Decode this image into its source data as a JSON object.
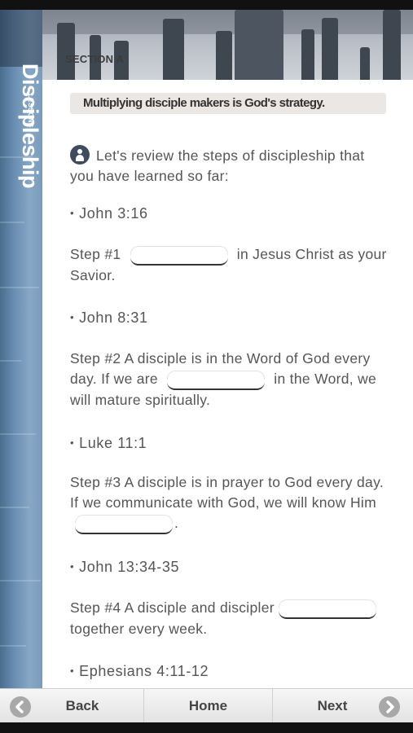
{
  "header": {
    "section_label": "SECTION A",
    "subtitle": "Multiplying disciple makers is God's strategy."
  },
  "sidebar": {
    "title": "Discipleship",
    "subtitle": "LESSONS"
  },
  "content": {
    "intro_icon": "info-person-icon",
    "intro": "Let's review the steps of discipleship that you have learned so far:",
    "blocks": [
      {
        "verse": "John 3:16",
        "step_before": "Step #1",
        "step_after": "in Jesus Christ as your Savior."
      },
      {
        "verse": "John 8:31",
        "step_line1": "Step #2 A disciple is in the Word of God every day. If we are",
        "step_after": "in the Word, we will mature spiritually."
      },
      {
        "verse": "Luke 11:1",
        "step_line1": "Step #3 A disciple is in prayer to God every day. If we communicate with God, we will know Him",
        "step_after": "."
      },
      {
        "verse": "John 13:34-35",
        "step_line1": "Step #4 A disciple and discipler",
        "step_after": "together every week."
      },
      {
        "verse": "Ephesians 4:11-12"
      }
    ]
  },
  "nav": {
    "back": "Back",
    "home": "Home",
    "next": "Next",
    "back_icon": "back-arrow-icon",
    "next_icon": "next-arrow-icon"
  }
}
